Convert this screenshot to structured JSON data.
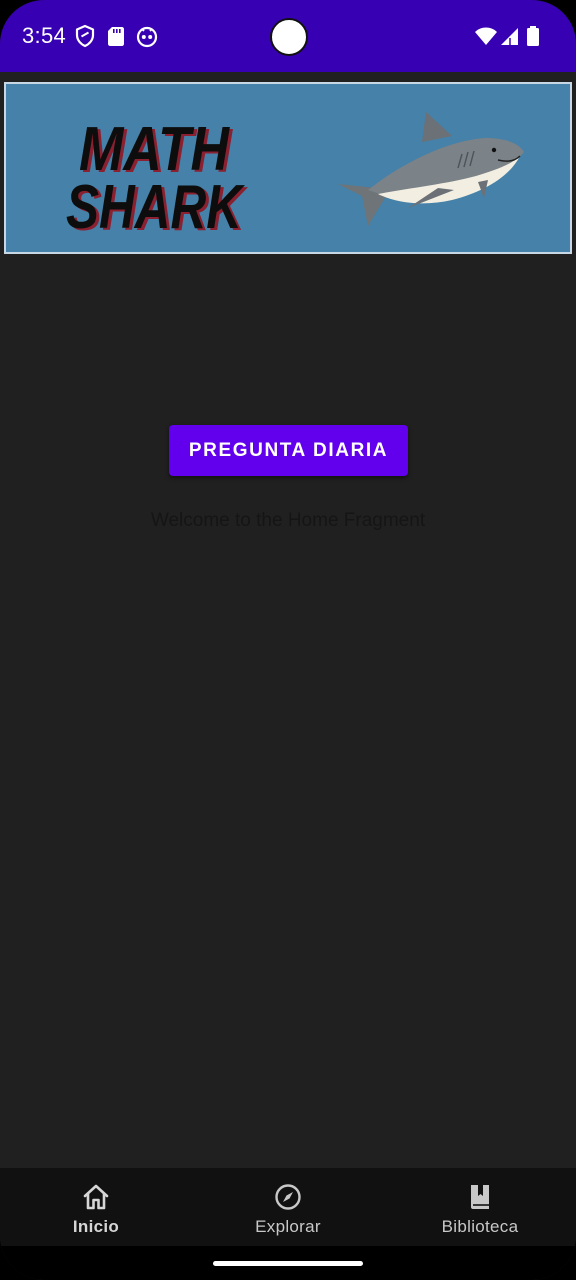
{
  "status_bar": {
    "time": "3:54",
    "background": "#3700B3",
    "left_icons": [
      "shield-icon",
      "sd-card-icon",
      "android-face-icon"
    ],
    "right_icons": [
      "wifi-icon",
      "cell-signal-icon",
      "battery-icon"
    ]
  },
  "banner": {
    "logo_line1": "MATH",
    "logo_line2": "SHARK",
    "background": "#4581A8",
    "image": "shark-illustration"
  },
  "main": {
    "daily_question_button": "PREGUNTA DIARIA",
    "welcome_text": "Welcome to the Home Fragment",
    "accent": "#6200EE"
  },
  "bottom_nav": {
    "items": [
      {
        "label": "Inicio",
        "icon": "home-icon",
        "active": true
      },
      {
        "label": "Explorar",
        "icon": "compass-icon",
        "active": false
      },
      {
        "label": "Biblioteca",
        "icon": "book-bookmark-icon",
        "active": false
      }
    ]
  }
}
